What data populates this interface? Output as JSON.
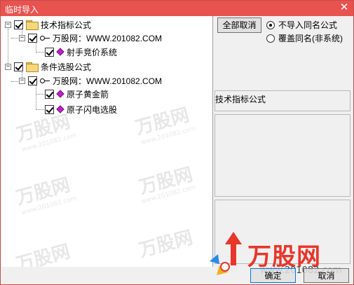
{
  "window": {
    "title": "临时导入",
    "close_glyph": "✕"
  },
  "tree": {
    "groups": [
      {
        "label": "技术指标公式",
        "expander": "−",
        "checked": true,
        "site": {
          "label": "万股网：WWW.201082.COM",
          "checked": true,
          "items": [
            {
              "label": "射手竞价系统",
              "checked": true
            }
          ]
        }
      },
      {
        "label": "条件选股公式",
        "expander": "−",
        "checked": true,
        "site": {
          "label": "万股网：WWW.201082.COM",
          "checked": true,
          "items": [
            {
              "label": "原子黄金箭",
              "checked": true
            },
            {
              "label": "原子闪电选股",
              "checked": true
            }
          ]
        }
      }
    ]
  },
  "options": {
    "cancel_all_label": "全部取消",
    "radio_no_import": "不导入同名公式",
    "radio_overwrite": "覆盖同名(非系统)",
    "selected": "no_import"
  },
  "info": {
    "formula_type_label": "技术指标公式"
  },
  "footer": {
    "ok_label": "确定",
    "cancel_label": "取消"
  },
  "watermark": {
    "logo_text": "万股网",
    "url_text": "www.201082.com"
  },
  "colors": {
    "titlebar": "#e8524f",
    "accent_red": "#e8362a",
    "gem": "#c020c8"
  },
  "icons": {
    "folder": "folder-icon",
    "key": "key-icon",
    "gem": "formula-gem-icon",
    "close": "close-icon"
  }
}
